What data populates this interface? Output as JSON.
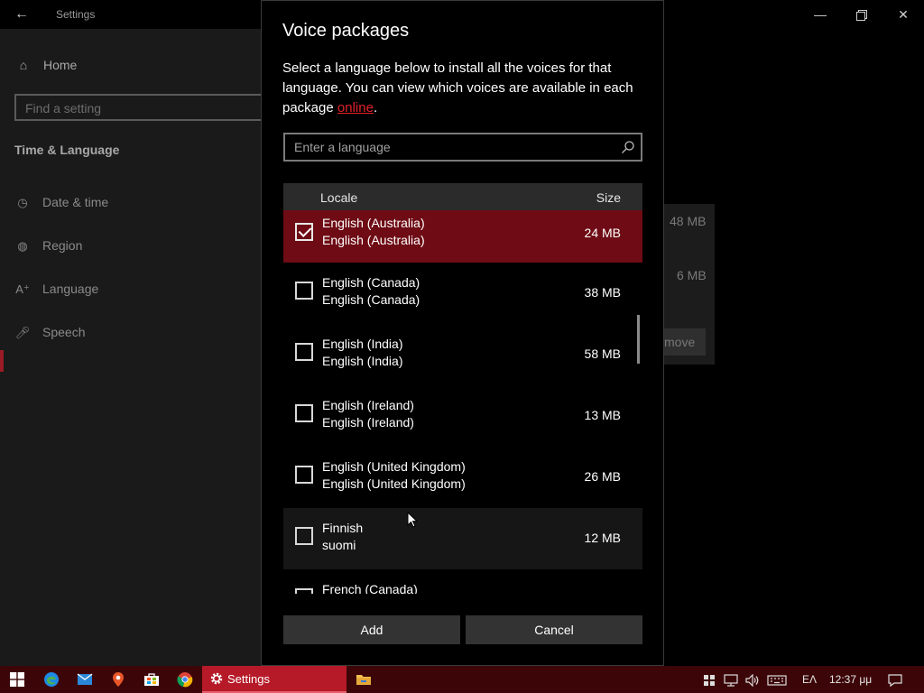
{
  "window": {
    "title": "Settings",
    "back_icon": "back-arrow-icon",
    "minimize_icon": "minimize-icon",
    "maximize_icon": "restore-icon",
    "close_icon": "close-icon"
  },
  "sidebar": {
    "home_label": "Home",
    "search_placeholder": "Find a setting",
    "section_title": "Time & Language",
    "items": [
      {
        "label": "Date & time",
        "icon": "calendar-clock-icon"
      },
      {
        "label": "Region",
        "icon": "globe-icon"
      },
      {
        "label": "Language",
        "icon": "language-icon"
      },
      {
        "label": "Speech",
        "icon": "microphone-icon"
      }
    ],
    "active_item": "Speech",
    "accent_color": "#9a1b25"
  },
  "background_content": {
    "sizes": [
      "48 MB",
      "6 MB"
    ],
    "remove_button_partial": "move"
  },
  "dialog": {
    "title": "Voice packages",
    "description_prefix": "Select a language below to install all the voices for that language. You can view which voices are available in each package ",
    "link_text": "online",
    "description_suffix": ".",
    "search_placeholder": "Enter a language",
    "columns": {
      "locale": "Locale",
      "size": "Size"
    },
    "rows": [
      {
        "name": "English (Australia)",
        "native": "English (Australia)",
        "size": "24 MB",
        "checked": true,
        "state": "selected"
      },
      {
        "name": "English (Canada)",
        "native": "English (Canada)",
        "size": "38 MB",
        "checked": false,
        "state": "normal"
      },
      {
        "name": "English (India)",
        "native": "English (India)",
        "size": "58 MB",
        "checked": false,
        "state": "normal"
      },
      {
        "name": "English (Ireland)",
        "native": "English (Ireland)",
        "size": "13 MB",
        "checked": false,
        "state": "normal"
      },
      {
        "name": "English (United Kingdom)",
        "native": "English (United Kingdom)",
        "size": "26 MB",
        "checked": false,
        "state": "normal"
      },
      {
        "name": "Finnish",
        "native": "suomi",
        "size": "12 MB",
        "checked": false,
        "state": "hover"
      },
      {
        "name": "French (Canada)",
        "native": "",
        "size": "",
        "checked": false,
        "state": "normal"
      }
    ],
    "add_label": "Add",
    "cancel_label": "Cancel",
    "selected_color": "#6e0b14",
    "link_color": "#e0202a"
  },
  "taskbar": {
    "apps": [
      "windows-start-icon",
      "edge-icon",
      "mail-icon",
      "maps-pin-icon",
      "store-icon",
      "chrome-icon",
      "file-explorer-icon"
    ],
    "active_app_label": "Settings",
    "tray_language": "ΕΛ",
    "clock": "12:37 μμ",
    "bar_color": "#3c0608",
    "active_color": "#b61a28"
  }
}
